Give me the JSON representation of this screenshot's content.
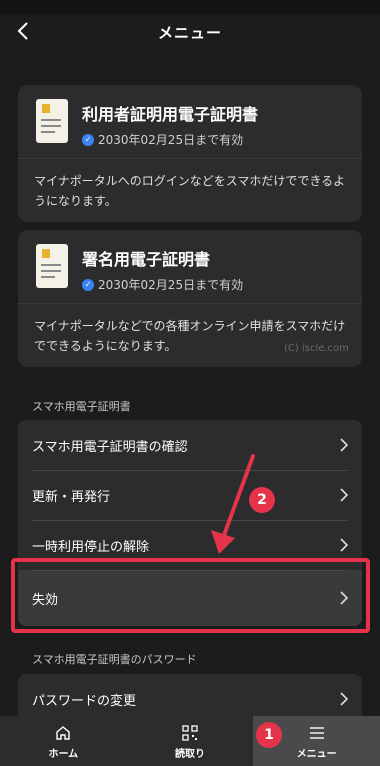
{
  "header": {
    "title": "メニュー"
  },
  "cards": [
    {
      "title": "利用者証明用電子証明書",
      "validity": "2030年02月25日まで有効",
      "description": "マイナポータルへのログインなどをスマホだけでできるようになります。"
    },
    {
      "title": "署名用電子証明書",
      "validity": "2030年02月25日まで有効",
      "description": "マイナポータルなどでの各種オンライン申請をスマホだけでできるようになります。"
    }
  ],
  "watermark": "(C) iscle.com",
  "section1": {
    "label": "スマホ用電子証明書",
    "items": [
      "スマホ用電子証明書の確認",
      "更新・再発行",
      "一時利用停止の解除",
      "失効"
    ]
  },
  "section2": {
    "label": "スマホ用電子証明書のパスワード",
    "items": [
      "パスワードの変更"
    ]
  },
  "annotations": {
    "badge1": "1",
    "badge2": "2",
    "color": "#e5334a"
  },
  "tabbar": {
    "home": "ホーム",
    "scan": "読取り",
    "menu": "メニュー",
    "active": "menu"
  }
}
